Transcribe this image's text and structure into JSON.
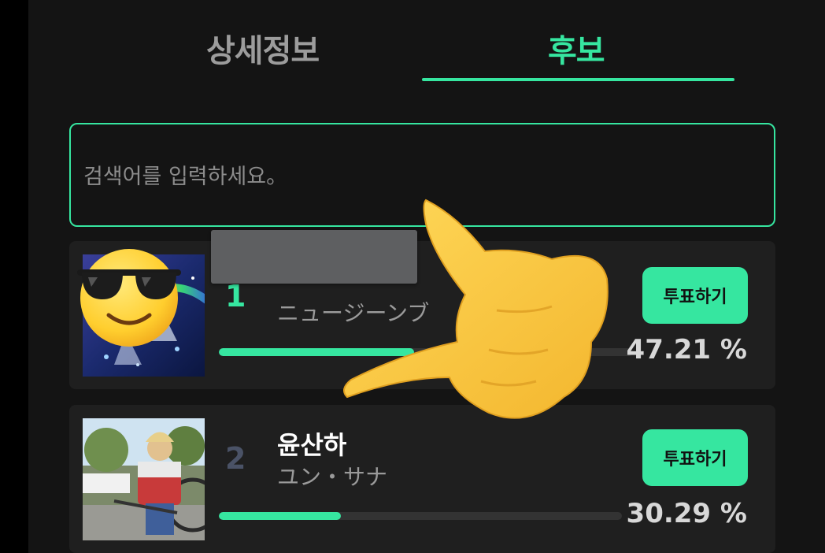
{
  "tabs": [
    {
      "label": "상세정보",
      "active": false
    },
    {
      "label": "후보",
      "active": true
    }
  ],
  "search": {
    "placeholder": "검색어를 입력하세요。"
  },
  "candidates": [
    {
      "rank": "1",
      "name": "",
      "subname": "ニュージーンブ",
      "vote_label": "투표하기",
      "percent_text": "47.21 %",
      "percent": 47.21
    },
    {
      "rank": "2",
      "name": "윤산하",
      "subname": "ユン・サナ",
      "vote_label": "투표하기",
      "percent_text": "30.29 %",
      "percent": 30.29
    }
  ],
  "colors": {
    "accent": "#36e6a0",
    "background": "#141414",
    "card": "#1f1f1f"
  },
  "overlays": [
    "sunglasses-emoji",
    "pointing-hand-emoji",
    "redaction-box"
  ]
}
